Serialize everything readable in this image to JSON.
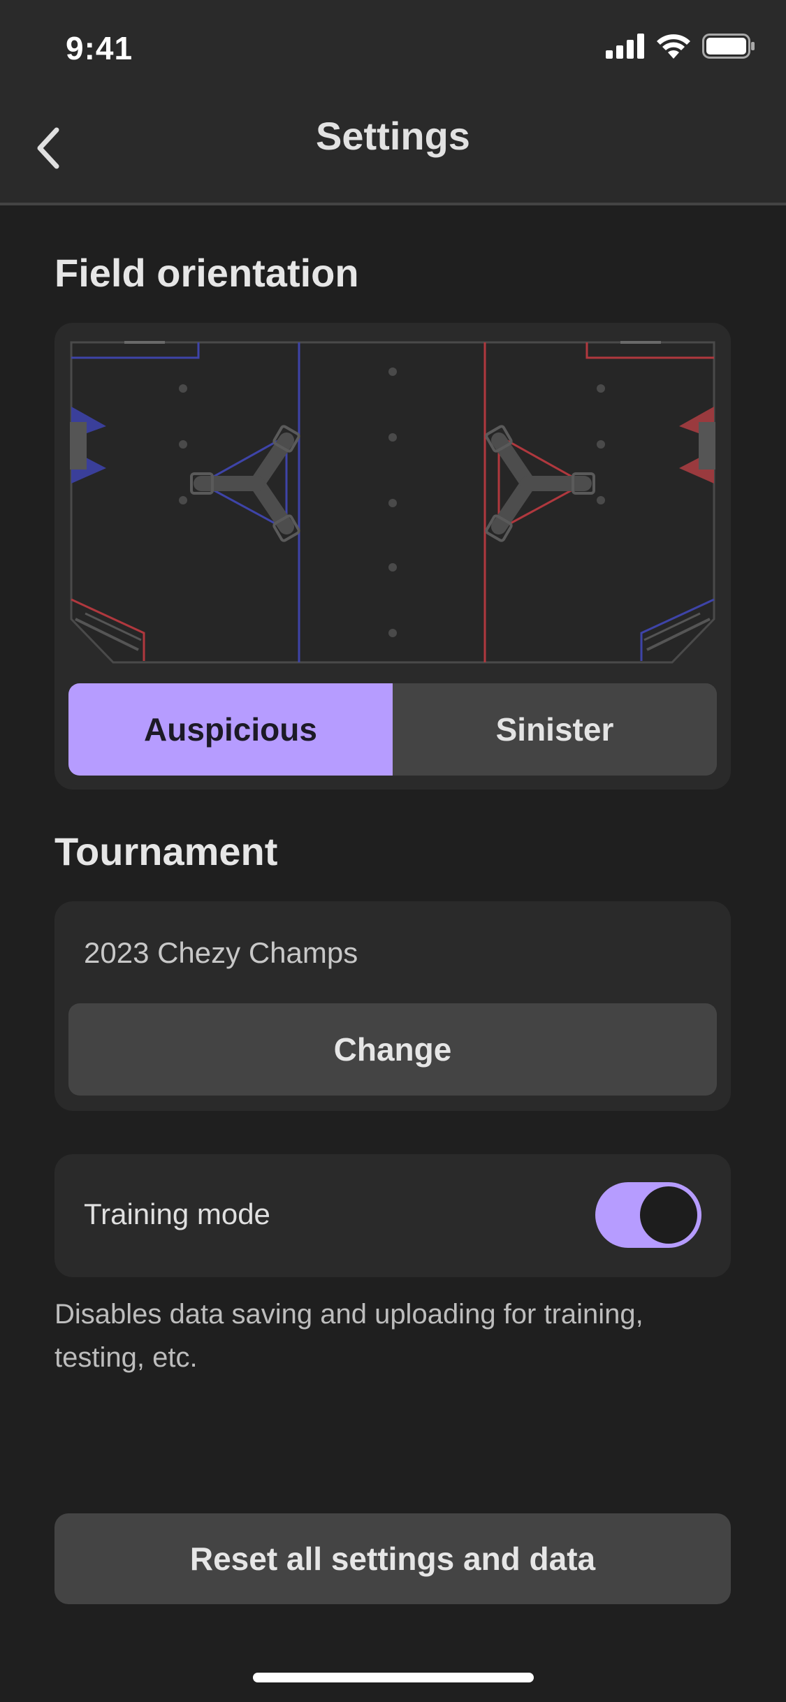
{
  "status_bar": {
    "time": "9:41"
  },
  "nav": {
    "title": "Settings"
  },
  "field_orientation": {
    "title": "Field orientation",
    "options": [
      "Auspicious",
      "Sinister"
    ],
    "selected": "Auspicious"
  },
  "tournament": {
    "title": "Tournament",
    "name": "2023 Chezy Champs",
    "change_label": "Change"
  },
  "training": {
    "label": "Training mode",
    "enabled": true,
    "helper": "Disables data saving and uploading for training, testing, etc."
  },
  "reset_label": "Reset all settings and data",
  "colors": {
    "accent": "#b69cff",
    "background": "#1f1f1f",
    "card": "#2a2a2a",
    "button": "#444444",
    "blue_alliance": "#3e44a8",
    "red_alliance": "#b0383e"
  }
}
